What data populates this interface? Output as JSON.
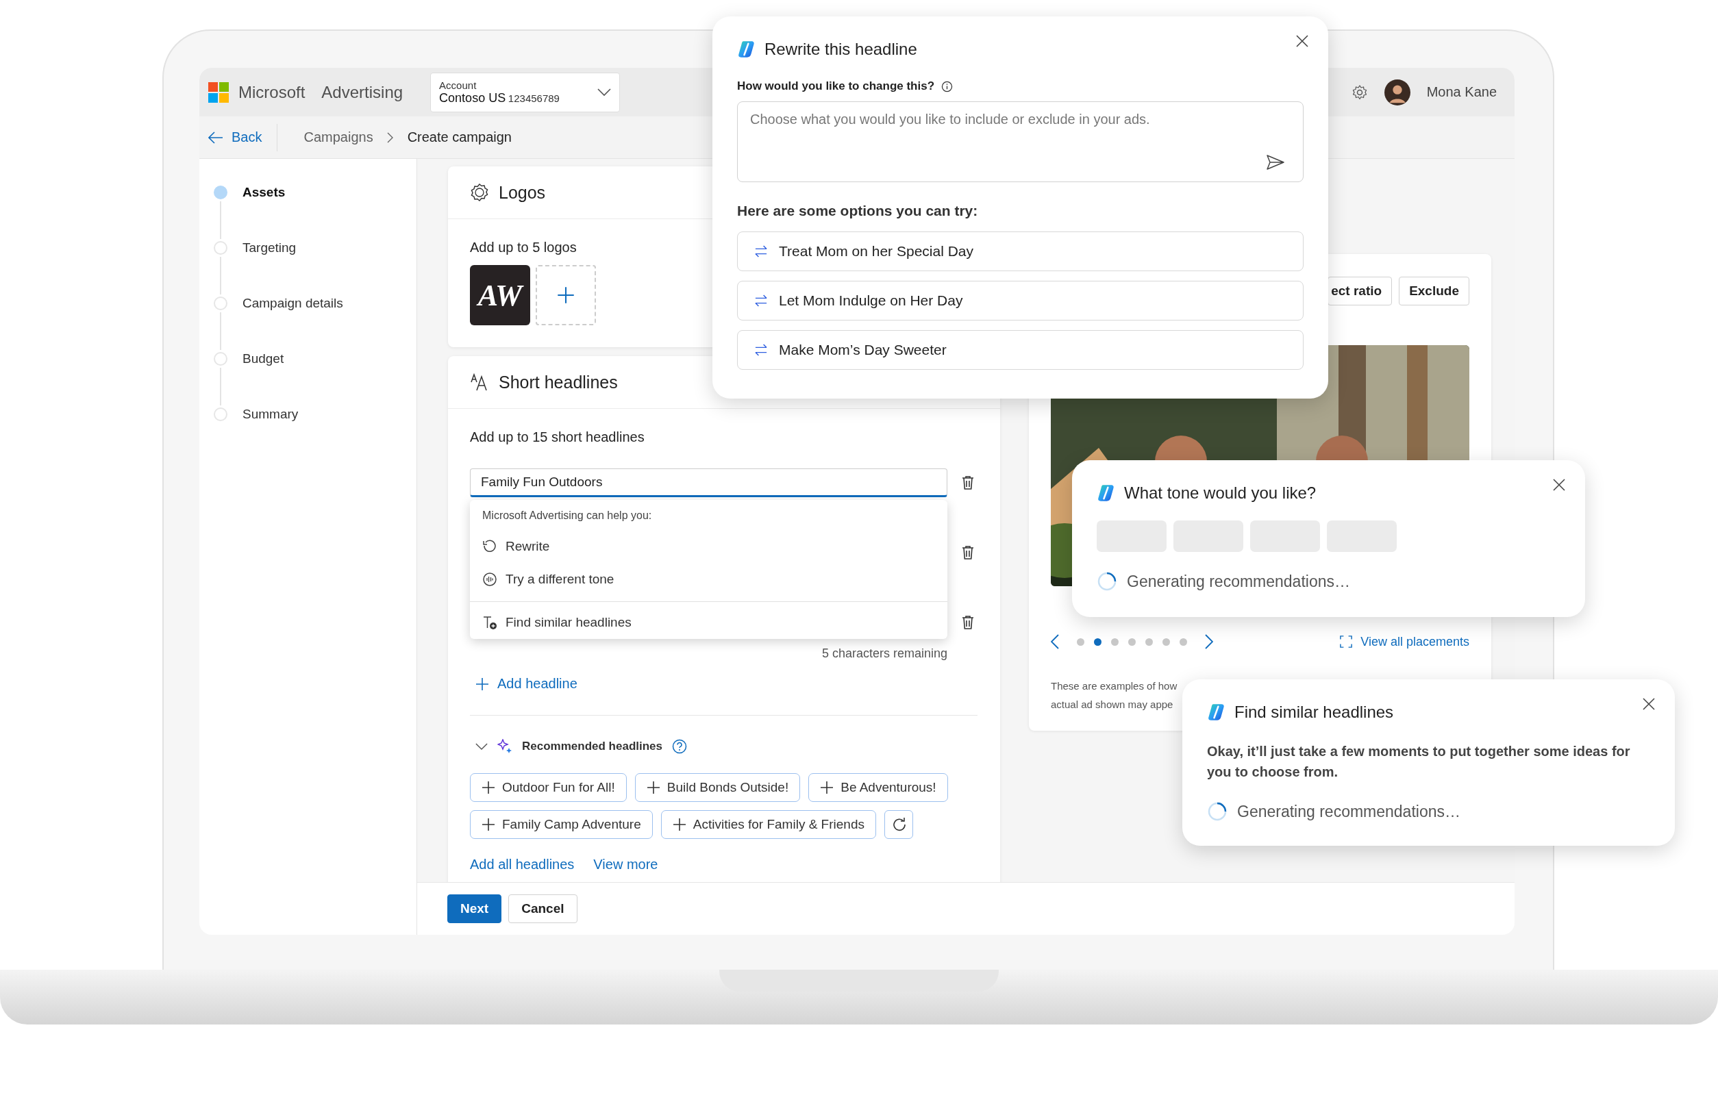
{
  "header": {
    "brand": "Microsoft",
    "product": "Advertising",
    "account": {
      "label": "Account",
      "name": "Contoso US",
      "number": "123456789"
    },
    "user": {
      "name": "Mona Kane"
    }
  },
  "breadcrumb": {
    "back": "Back",
    "items": [
      "Campaigns",
      "Create campaign"
    ]
  },
  "steps": [
    {
      "label": "Assets",
      "selected": true
    },
    {
      "label": "Targeting",
      "selected": false
    },
    {
      "label": "Campaign details",
      "selected": false
    },
    {
      "label": "Budget",
      "selected": false
    },
    {
      "label": "Summary",
      "selected": false
    }
  ],
  "logos": {
    "title": "Logos",
    "hint": "Add up to 5 logos",
    "logo_text": "AW"
  },
  "short_headlines": {
    "title": "Short headlines",
    "hint": "Add up to 15 short headlines",
    "field": {
      "value": "Family Fun Outdoors"
    },
    "remaining": "5 characters remaining",
    "add": "Add headline",
    "recommended": {
      "title": "Recommended headlines",
      "expanded": true,
      "chips": [
        "Outdoor Fun for All!",
        "Build Bonds Outside!",
        "Be Adventurous!",
        "Family Camp Adventure",
        "Activities for Family & Friends"
      ]
    },
    "add_all": "Add all headlines",
    "view_more": "View more"
  },
  "assist_menu": {
    "heading": "Microsoft Advertising can help you:",
    "items": [
      {
        "kind": "rewrite",
        "label": "Rewrite"
      },
      {
        "kind": "tone",
        "label": "Try a different tone"
      },
      {
        "kind": "similar",
        "label": "Find similar headlines"
      }
    ]
  },
  "preview": {
    "buttons": [
      "ect ratio",
      "Exclude"
    ],
    "picture": {
      "kind": "picture"
    },
    "dots": [
      {
        "selected": false
      },
      {
        "selected": true
      },
      {
        "selected": false
      },
      {
        "selected": false
      },
      {
        "selected": false
      },
      {
        "selected": false
      },
      {
        "selected": false
      }
    ],
    "view_all": "View all placements",
    "note": [
      "These are examples of how",
      "actual ad shown may appe"
    ]
  },
  "footer": {
    "buttons": [
      {
        "label": "Next",
        "kind": "primary"
      },
      {
        "label": "Cancel",
        "kind": "secondary"
      }
    ]
  },
  "rewrite_dialog": {
    "title": "Rewrite this headline",
    "question": "How would you like to change this?",
    "placeholder": "Choose what you would you like to include or exclude in your ads.",
    "options_heading": "Here are some options you can try:",
    "options": [
      "Treat Mom on her Special Day",
      "Let Mom Indulge on Her Day",
      "Make Mom’s Day Sweeter"
    ]
  },
  "tone_dialog": {
    "title": "What tone would you like?",
    "status": "Generating recommendations…"
  },
  "similar_dialog": {
    "title": "Find similar headlines",
    "message": "Okay, it’ll just take a few moments to put together some ideas for you to choose from.",
    "status": "Generating recommendations…"
  }
}
